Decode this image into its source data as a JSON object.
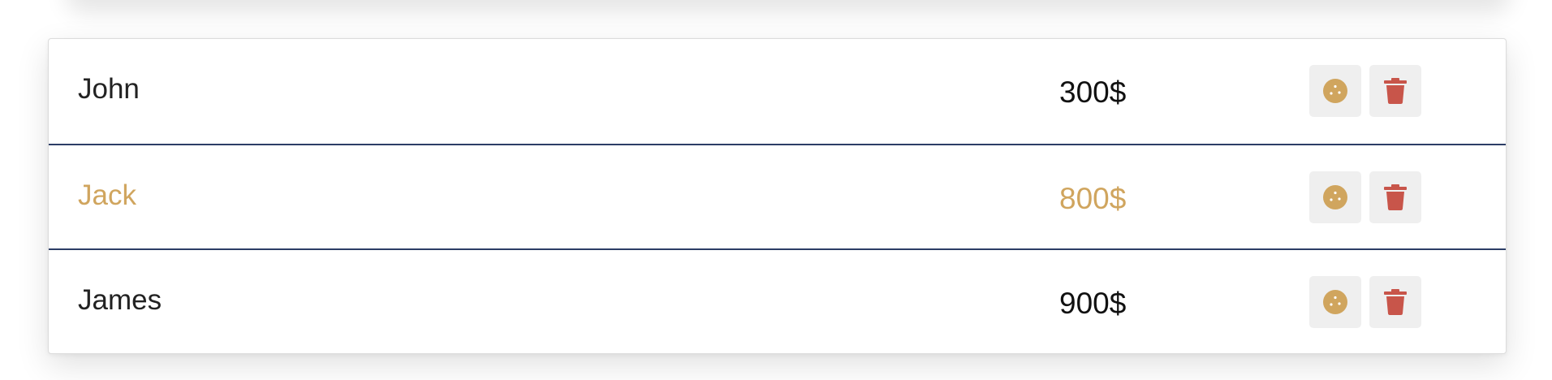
{
  "colors": {
    "accent": "#d0a55e",
    "delete": "#c8554a",
    "divider": "#2c3e66",
    "button_bg": "#efefef"
  },
  "rows": [
    {
      "name": "John",
      "price": "300$",
      "highlighted": false,
      "edit_icon": "cookie-icon",
      "delete_icon": "trash-icon"
    },
    {
      "name": "Jack",
      "price": "800$",
      "highlighted": true,
      "edit_icon": "cookie-icon",
      "delete_icon": "trash-icon"
    },
    {
      "name": "James",
      "price": "900$",
      "highlighted": false,
      "edit_icon": "cookie-icon",
      "delete_icon": "trash-icon"
    }
  ]
}
